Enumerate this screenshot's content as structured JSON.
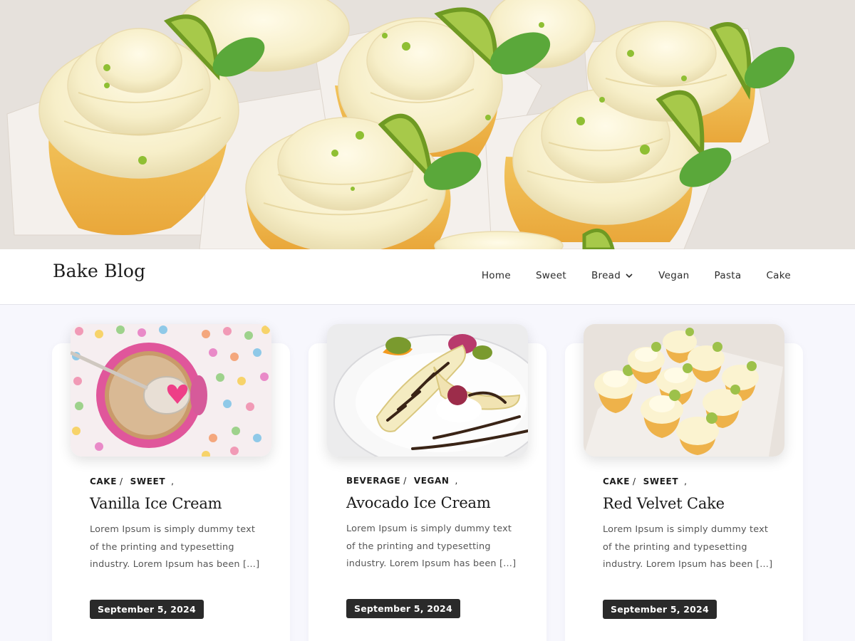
{
  "site": {
    "title": "Bake Blog"
  },
  "nav": {
    "items": [
      {
        "label": "Home"
      },
      {
        "label": "Sweet"
      },
      {
        "label": "Bread"
      },
      {
        "label": "Vegan"
      },
      {
        "label": "Pasta"
      },
      {
        "label": "Cake"
      }
    ]
  },
  "posts": [
    {
      "cat1": "CAKE",
      "cat2": "SWEET",
      "sep": "/",
      "comma": ",",
      "title": "Vanilla Ice Cream",
      "excerpt": "Lorem Ipsum is simply dummy text of the printing and typesetting industry. Lorem Ipsum has been […]",
      "date": "September 5, 2024"
    },
    {
      "cat1": "BEVERAGE",
      "cat2": "VEGAN",
      "sep": "/",
      "comma": ",",
      "title": "Avocado Ice Cream",
      "excerpt": "Lorem Ipsum is simply dummy text of the printing and typesetting industry. Lorem Ipsum has been […]",
      "date": "September 5, 2024"
    },
    {
      "cat1": "CAKE",
      "cat2": "SWEET",
      "sep": "/",
      "comma": ",",
      "title": "Red Velvet Cake",
      "excerpt": "Lorem Ipsum is simply dummy text of the printing and typesetting industry. Lorem Ipsum has been […]",
      "date": "September 5, 2024"
    }
  ],
  "colors": {
    "accent": "#2a2a2a",
    "background": "#f7f7fd"
  }
}
